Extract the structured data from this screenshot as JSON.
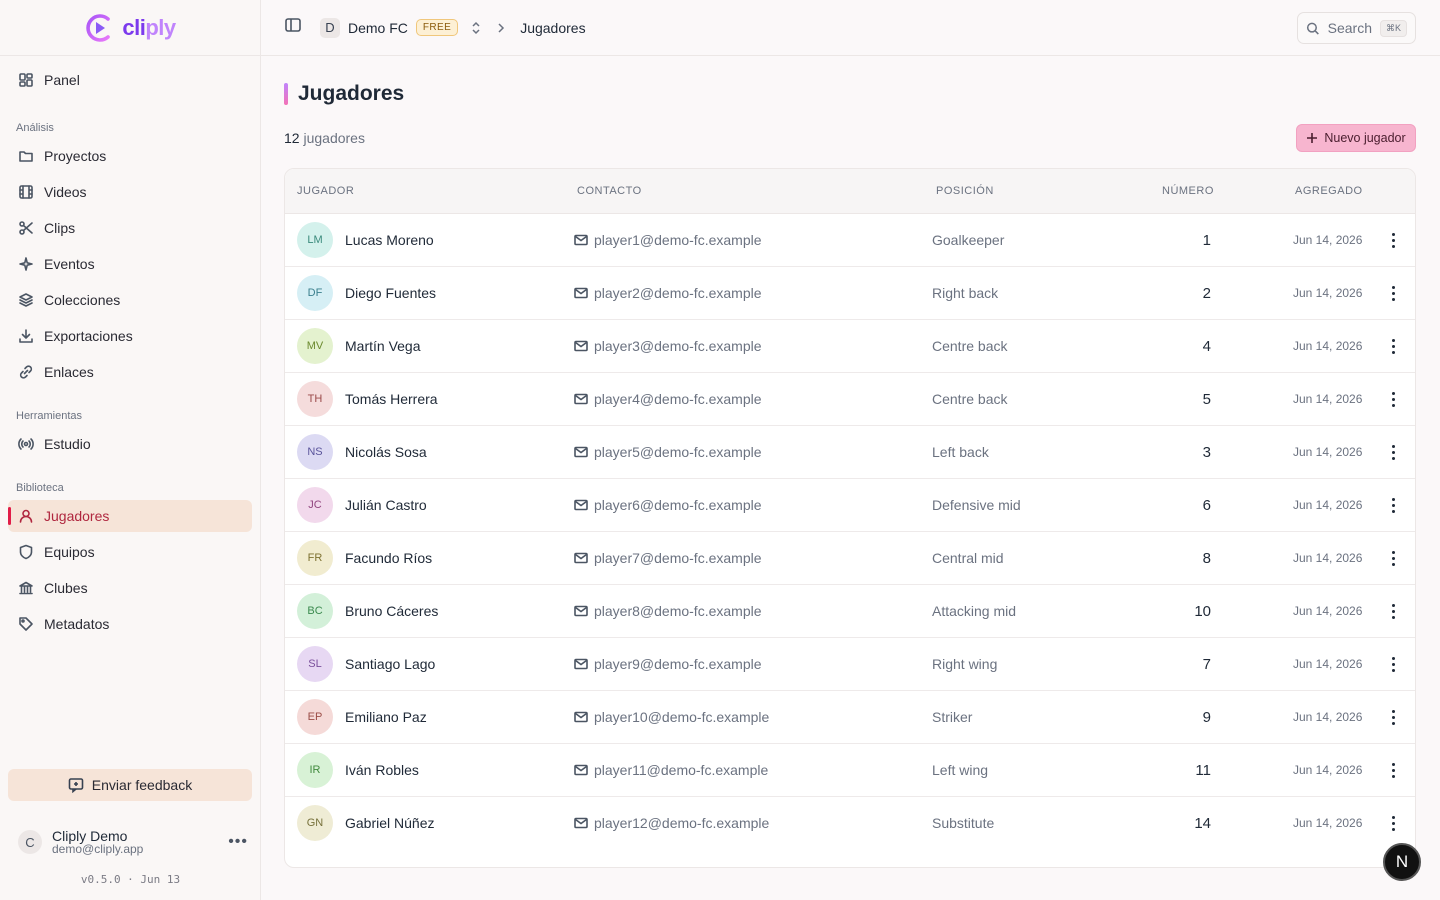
{
  "app": {
    "logo_text_a": "cli",
    "logo_text_b": "ply"
  },
  "sidebar": {
    "panel": "Panel",
    "sections": [
      {
        "label": "Análisis",
        "items": [
          "Proyectos",
          "Videos",
          "Clips",
          "Eventos",
          "Colecciones",
          "Exportaciones",
          "Enlaces"
        ]
      },
      {
        "label": "Herramientas",
        "items": [
          "Estudio"
        ]
      },
      {
        "label": "Biblioteca",
        "items": [
          "Jugadores",
          "Equipos",
          "Clubes",
          "Metadatos"
        ]
      }
    ],
    "feedback": "Enviar feedback",
    "user": {
      "initial": "C",
      "name": "Cliply Demo",
      "email": "demo@cliply.app"
    },
    "version": "v0.5.0 · Jun 13"
  },
  "header": {
    "org_initial": "D",
    "org": "Demo FC",
    "plan": "FREE",
    "current": "Jugadores",
    "search": "Search",
    "shortcut": "⌘K"
  },
  "main": {
    "title": "Jugadores",
    "count_num": "12",
    "count_label": "jugadores",
    "new_button": "Nuevo jugador",
    "columns": [
      "JUGADOR",
      "CONTACTO",
      "POSICIÓN",
      "NÚMERO",
      "AGREGADO"
    ],
    "players": [
      {
        "initials": "LM",
        "name": "Lucas Moreno",
        "email": "player1@demo-fc.example",
        "position": "Goalkeeper",
        "number": "1",
        "date": "Jun 14, 2026",
        "bg": "#d4f1ec",
        "fg": "#3a8a7c"
      },
      {
        "initials": "DF",
        "name": "Diego Fuentes",
        "email": "player2@demo-fc.example",
        "position": "Right back",
        "number": "2",
        "date": "Jun 14, 2026",
        "bg": "#d6eff5",
        "fg": "#3a7f8d"
      },
      {
        "initials": "MV",
        "name": "Martín Vega",
        "email": "player3@demo-fc.example",
        "position": "Centre back",
        "number": "4",
        "date": "Jun 14, 2026",
        "bg": "#e4f2cf",
        "fg": "#6b8a2e"
      },
      {
        "initials": "TH",
        "name": "Tomás Herrera",
        "email": "player4@demo-fc.example",
        "position": "Centre back",
        "number": "5",
        "date": "Jun 14, 2026",
        "bg": "#f5dcdc",
        "fg": "#9b4a4a"
      },
      {
        "initials": "NS",
        "name": "Nicolás Sosa",
        "email": "player5@demo-fc.example",
        "position": "Left back",
        "number": "3",
        "date": "Jun 14, 2026",
        "bg": "#dcdaf3",
        "fg": "#5a549b"
      },
      {
        "initials": "JC",
        "name": "Julián Castro",
        "email": "player6@demo-fc.example",
        "position": "Defensive mid",
        "number": "6",
        "date": "Jun 14, 2026",
        "bg": "#f2d9ec",
        "fg": "#92467f"
      },
      {
        "initials": "FR",
        "name": "Facundo Ríos",
        "email": "player7@demo-fc.example",
        "position": "Central mid",
        "number": "8",
        "date": "Jun 14, 2026",
        "bg": "#f1ecd0",
        "fg": "#7d7131"
      },
      {
        "initials": "BC",
        "name": "Bruno Cáceres",
        "email": "player8@demo-fc.example",
        "position": "Attacking mid",
        "number": "10",
        "date": "Jun 14, 2026",
        "bg": "#d3f0d9",
        "fg": "#3b8a4f"
      },
      {
        "initials": "SL",
        "name": "Santiago Lago",
        "email": "player9@demo-fc.example",
        "position": "Right wing",
        "number": "7",
        "date": "Jun 14, 2026",
        "bg": "#e7d8f3",
        "fg": "#7a4f9b"
      },
      {
        "initials": "EP",
        "name": "Emiliano Paz",
        "email": "player10@demo-fc.example",
        "position": "Striker",
        "number": "9",
        "date": "Jun 14, 2026",
        "bg": "#f5dad8",
        "fg": "#9b4d47"
      },
      {
        "initials": "IR",
        "name": "Iván Robles",
        "email": "player11@demo-fc.example",
        "position": "Left wing",
        "number": "11",
        "date": "Jun 14, 2026",
        "bg": "#d8f2d6",
        "fg": "#418a3d"
      },
      {
        "initials": "GN",
        "name": "Gabriel Núñez",
        "email": "player12@demo-fc.example",
        "position": "Substitute",
        "number": "14",
        "date": "Jun 14, 2026",
        "bg": "#efecd5",
        "fg": "#77713b"
      }
    ]
  },
  "dev_badge": "N"
}
